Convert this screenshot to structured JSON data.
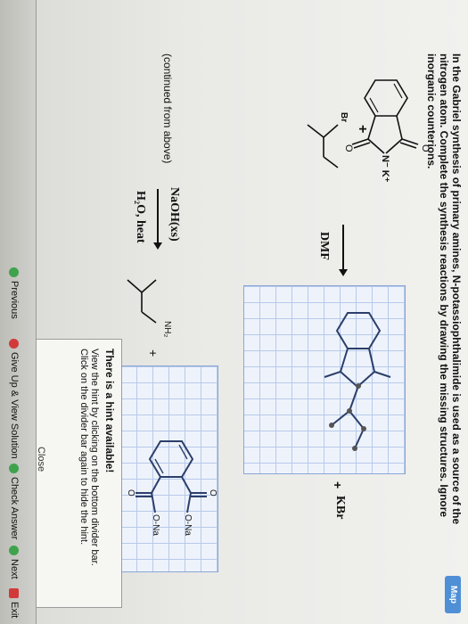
{
  "header": {
    "map_label": "Map"
  },
  "problem": {
    "text": "In the Gabriel synthesis of primary amines, N-potassiophthalimide is used as a source of the nitrogen atom. Complete the synthesis reactions by drawing the missing structures. Ignore inorganic counterions."
  },
  "reaction1": {
    "reactant_label_nk": "N⁻ K⁺",
    "reactant_label_o_top": "O",
    "reactant_label_o_bottom": "O",
    "plus": "+",
    "alkyl_halide_label": "Br",
    "reagent": "DMF",
    "byproduct_plus": "+",
    "byproduct": "KBr"
  },
  "reaction2": {
    "continued": "(continued from above)",
    "reagent_top": "NaOH(xs)",
    "reagent_bottom": "H₂O, heat",
    "product_label": "NH₂",
    "plus": "+",
    "product2_label_top": "O",
    "product2_label_ona1": "O-Na",
    "product2_label_ona2": "O-Na",
    "product2_label_o_bottom": "O"
  },
  "hint": {
    "title": "There is a hint available!",
    "body": "View the hint by clicking on the bottom divider bar. Click on the divider bar again to hide the hint.",
    "close": "Close"
  },
  "footer": {
    "previous": "Previous",
    "give_up": "Give Up & View Solution",
    "check_answer": "Check Answer",
    "next": "Next",
    "exit": "Exit"
  }
}
